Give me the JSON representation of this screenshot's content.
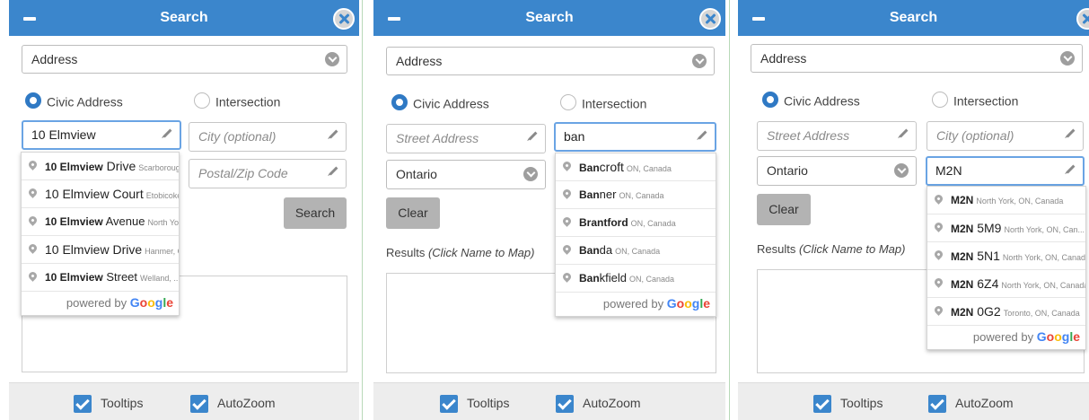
{
  "title": "Search",
  "search_type": "Address",
  "radio_civic": "Civic Address",
  "radio_intersection": "Intersection",
  "placeholders": {
    "street": "Street Address",
    "city": "City (optional)",
    "postal": "Postal/Zip Code"
  },
  "search_button": "Search",
  "clear_button": "Clear",
  "results_prefix": "Results ",
  "results_hint": "(Click Name to Map)",
  "tooltips_label": "Tooltips",
  "autozoom_label": "AutoZoom",
  "powered_by": "powered by ",
  "google": [
    "G",
    "o",
    "o",
    "g",
    "l",
    "e"
  ],
  "colors": {
    "accent": "#3b86cc",
    "button_gray": "#b3b3b3"
  },
  "panel1": {
    "street_value": "10 Elmview",
    "suggestions": [
      {
        "match": "10 Elmview",
        "rest": " Drive",
        "secondary": "Scarborough, ..."
      },
      {
        "match": "10 Elmview",
        "rest": " Court",
        "secondary": "Etobicoke, ..."
      },
      {
        "match": "10 Elmview",
        "rest": " Avenue",
        "secondary": "North Yo..."
      },
      {
        "match": "10 Elmview",
        "rest": " Drive",
        "secondary": "Hanmer, O..."
      },
      {
        "match": "10 Elmview",
        "rest": " Street",
        "secondary": "Welland, ..."
      }
    ]
  },
  "panel2": {
    "province": "Ontario",
    "city_value": "ban",
    "suggestions": [
      {
        "match": "Ban",
        "rest": "croft",
        "secondary": "ON, Canada"
      },
      {
        "match": "Ban",
        "rest": "ner",
        "secondary": "ON, Canada"
      },
      {
        "match": "Brantford",
        "rest": "",
        "secondary": "ON, Canada"
      },
      {
        "match": "Ban",
        "rest": "da",
        "secondary": "ON, Canada"
      },
      {
        "match": "Ban",
        "rest": "kfield",
        "secondary": "ON, Canada"
      }
    ]
  },
  "panel3": {
    "province": "Ontario",
    "postal_value": "M2N",
    "suggestions": [
      {
        "match": "M2N",
        "rest": "",
        "secondary": "North York, ON, Canada"
      },
      {
        "match": "M2N",
        "rest": " 5M9",
        "secondary": "North York, ON, Can..."
      },
      {
        "match": "M2N",
        "rest": " 5N1",
        "secondary": "North York, ON, Canada"
      },
      {
        "match": "M2N",
        "rest": " 6Z4",
        "secondary": "North York, ON, Canada"
      },
      {
        "match": "M2N",
        "rest": " 0G2",
        "secondary": "Toronto, ON, Canada"
      }
    ]
  }
}
